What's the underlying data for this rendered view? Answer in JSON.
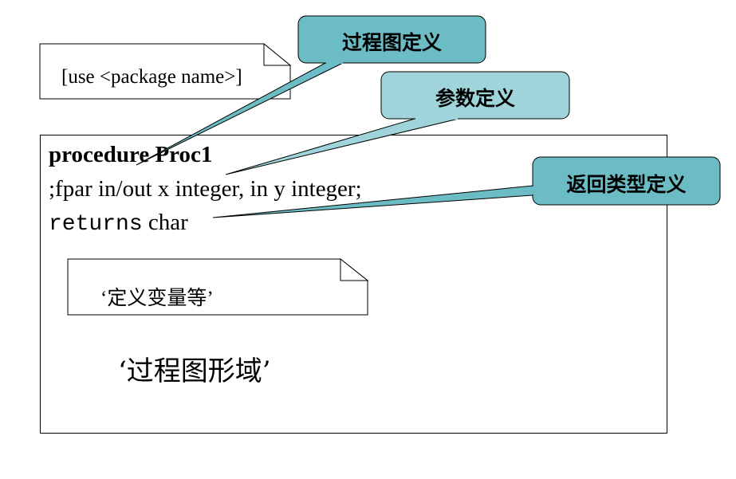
{
  "use_note": {
    "text": "[use <package name>]"
  },
  "procedure": {
    "keyword": "procedure",
    "name": "Proc1",
    "params_line": ";fpar in/out x integer, in y integer;",
    "returns_keyword": "returns",
    "return_type": "char"
  },
  "variables_note": {
    "text": "‘定义变量等’"
  },
  "graph_area": {
    "text": "‘过程图形域’"
  },
  "callouts": {
    "procedure_def": "过程图定义",
    "param_def": "参数定义",
    "return_def": "返回类型定义"
  },
  "colors": {
    "callout_dark": "#6bbcc4",
    "callout_light": "#9fd5da",
    "stroke": "#000000"
  }
}
